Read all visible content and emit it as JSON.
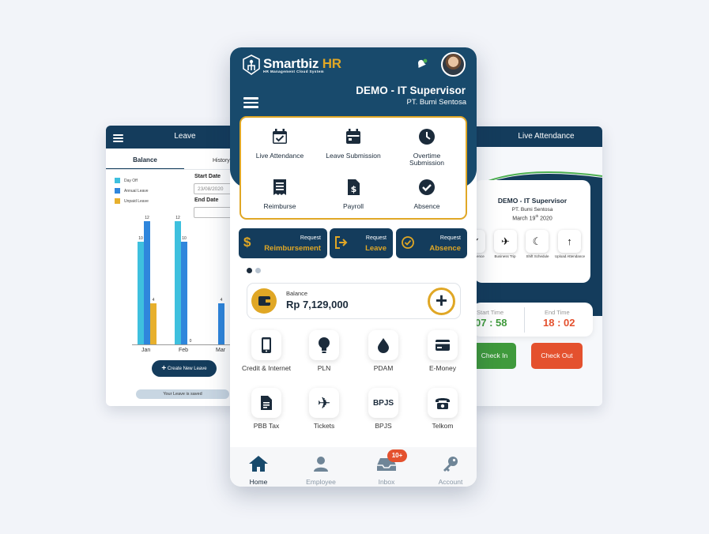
{
  "leave_screen": {
    "title": "Leave",
    "tabs": [
      "Balance",
      "History"
    ],
    "legend": [
      {
        "label": "Day Off",
        "color": "#3ec0de"
      },
      {
        "label": "Annual Leave",
        "color": "#2f86dc"
      },
      {
        "label": "Unpaid Leave",
        "color": "#e7b02d"
      }
    ],
    "start_date_label": "Start Date",
    "start_date_value": "23/08/2020",
    "end_date_label": "End Date",
    "create_button": "Create New Leave",
    "saved_message": "Your Leave is saved",
    "chart_data": {
      "type": "bar",
      "categories": [
        "Jan",
        "Feb",
        "Mar"
      ],
      "series": [
        {
          "name": "Day Off",
          "values": [
            10,
            12,
            null
          ]
        },
        {
          "name": "Annual Leave",
          "values": [
            12,
            10,
            4
          ]
        },
        {
          "name": "Unpaid Leave",
          "values": [
            4,
            0,
            0
          ]
        }
      ],
      "ylim": [
        0,
        12
      ]
    }
  },
  "attendance_screen": {
    "title": "Live Attendance",
    "name": "DEMO - IT Supervisor",
    "company": "PT. Bumi Sentosa",
    "date": "March 19",
    "date_sup": "th",
    "date_year": "2020",
    "actions": [
      {
        "label": "Absence",
        "icon": "check-icon"
      },
      {
        "label": "Business Trip",
        "icon": "plane-icon"
      },
      {
        "label": "Shift Schedule",
        "icon": "moon-icon"
      },
      {
        "label": "Upload Attendance",
        "icon": "upload-icon"
      }
    ],
    "start_time_label": "Start Time",
    "start_time": "07 : 58",
    "end_time_label": "End Time",
    "end_time": "18 : 02",
    "check_in": "Check In",
    "check_out": "Check Out"
  },
  "home": {
    "brand": "Smartbiz",
    "brand_hr": "HR",
    "brand_tagline": "HR Management Cloud System",
    "title": "DEMO - IT Supervisor",
    "company": "PT. Bumi Sentosa",
    "menu": [
      {
        "label": "Live Attendance",
        "icon": "calendar-check-icon"
      },
      {
        "label": "Leave Submission",
        "icon": "calendar-icon"
      },
      {
        "label": "Overtime Submission",
        "icon": "clock-icon"
      },
      {
        "label": "Reimburse",
        "icon": "receipt-icon"
      },
      {
        "label": "Payroll",
        "icon": "payroll-doc-icon"
      },
      {
        "label": "Absence",
        "icon": "check-circle-icon"
      }
    ],
    "requests": [
      {
        "small": "Request",
        "big": "Reimbursement",
        "icon": "dollar-icon"
      },
      {
        "small": "Request",
        "big": "Leave",
        "icon": "exit-icon"
      },
      {
        "small": "Request",
        "big": "Absence",
        "icon": "check-circle-icon"
      }
    ],
    "balance_label": "Balance",
    "balance_value": "Rp 7,129,000",
    "services": [
      {
        "label": "Credit & Internet",
        "icon": "phone-icon"
      },
      {
        "label": "PLN",
        "icon": "bulb-icon"
      },
      {
        "label": "PDAM",
        "icon": "drop-icon"
      },
      {
        "label": "E-Money",
        "icon": "card-icon"
      },
      {
        "label": "PBB Tax",
        "icon": "document-icon"
      },
      {
        "label": "Tickets",
        "icon": "plane-icon"
      },
      {
        "label": "BPJS",
        "icon": "bpjs-text",
        "text": "BPJS"
      },
      {
        "label": "Telkom",
        "icon": "telephone-icon"
      }
    ],
    "nav": [
      {
        "label": "Home",
        "icon": "home-icon"
      },
      {
        "label": "Employee",
        "icon": "user-icon"
      },
      {
        "label": "Inbox",
        "icon": "inbox-icon",
        "badge": "10+"
      },
      {
        "label": "Account",
        "icon": "key-icon"
      }
    ]
  },
  "colors": {
    "navy": "#143c5c",
    "gold": "#e0a725",
    "green": "#3f9a3c",
    "orange": "#e4512e"
  }
}
